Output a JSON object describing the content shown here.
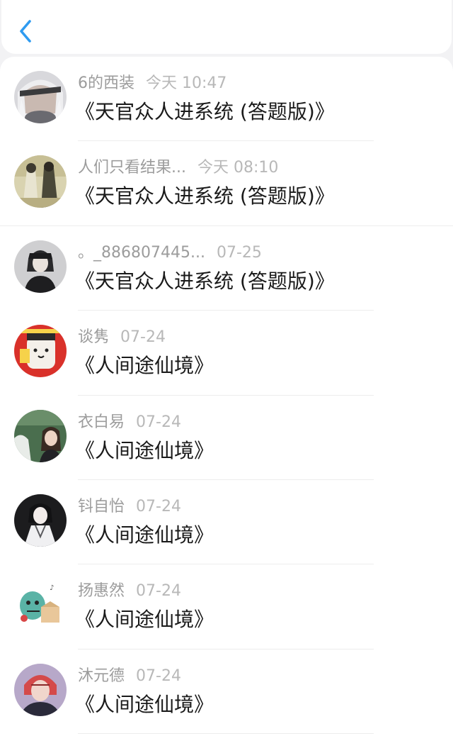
{
  "header": {
    "back_icon": "chevron-left-icon",
    "accent_color": "#2f9bf0"
  },
  "messages": [
    {
      "name": "6的西装",
      "time": "今天 10:47",
      "title": "《天官众人进系统 (答题版)》"
    },
    {
      "name": "人们只看结果...",
      "time": "今天 08:10",
      "title": "《天官众人进系统 (答题版)》"
    },
    {
      "name": "。_886807445...",
      "time": "07-25",
      "title": "《天官众人进系统 (答题版)》"
    },
    {
      "name": "谈隽",
      "time": "07-24",
      "title": "《人间途仙境》"
    },
    {
      "name": "衣白易",
      "time": "07-24",
      "title": "《人间途仙境》"
    },
    {
      "name": "钭自怡",
      "time": "07-24",
      "title": "《人间途仙境》"
    },
    {
      "name": "扬惠然",
      "time": "07-24",
      "title": "《人间途仙境》"
    },
    {
      "name": "沐元德",
      "time": "07-24",
      "title": "《人间途仙境》"
    }
  ]
}
